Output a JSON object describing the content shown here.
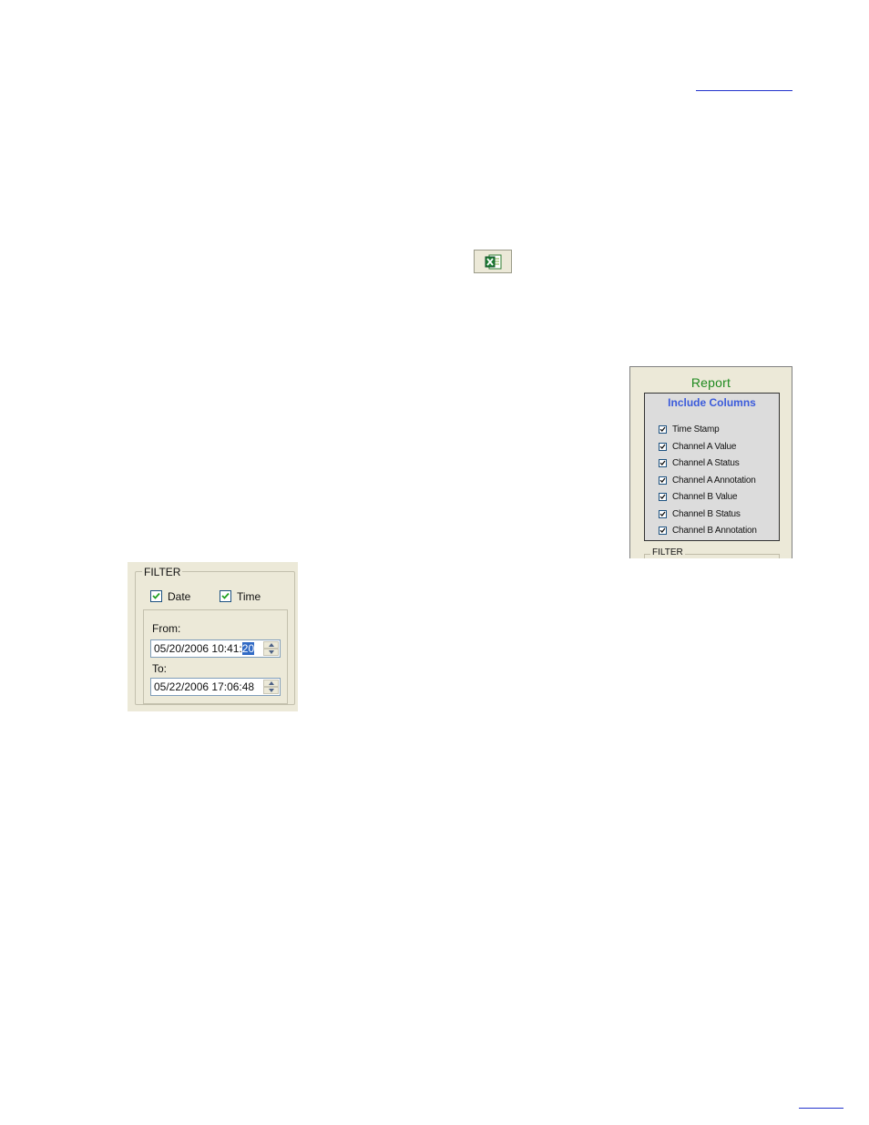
{
  "report": {
    "title": "Report",
    "include_columns_title": "Include Columns",
    "columns": [
      {
        "label": "Time Stamp",
        "checked": true
      },
      {
        "label": "Channel A Value",
        "checked": true
      },
      {
        "label": "Channel A Status",
        "checked": true
      },
      {
        "label": "Channel A Annotation",
        "checked": true
      },
      {
        "label": "Channel B Value",
        "checked": true
      },
      {
        "label": "Channel B Status",
        "checked": true
      },
      {
        "label": "Channel B Annotation",
        "checked": true
      }
    ],
    "filter_label": "FILTER"
  },
  "filter": {
    "label": "FILTER",
    "date_label": "Date",
    "date_checked": true,
    "time_label": "Time",
    "time_checked": true,
    "from_label": "From:",
    "from_value_prefix": "05/20/2006 10:41:",
    "from_value_selected": "20",
    "to_label": "To:",
    "to_value": "05/22/2006 17:06:48"
  },
  "toolbar": {
    "excel_icon": "excel-icon"
  },
  "colors": {
    "panel_bg": "#ece9d8",
    "report_title": "#1f8a1f",
    "include_columns_title": "#3b5bdb",
    "selection": "#316ac5",
    "link": "#2233cc"
  }
}
